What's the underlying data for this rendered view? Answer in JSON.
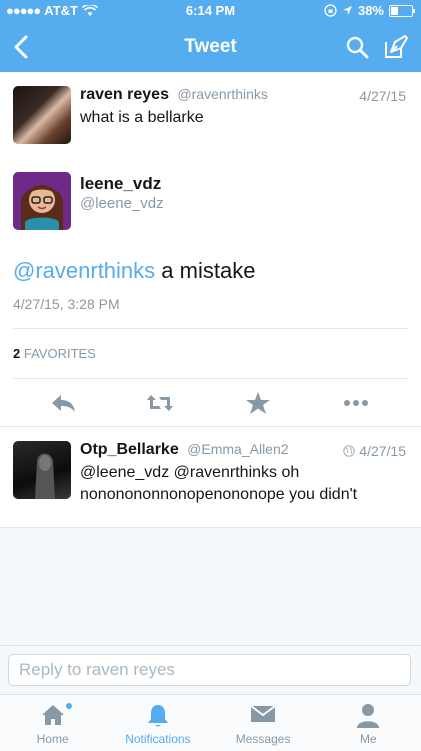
{
  "status_bar": {
    "carrier": "AT&T",
    "time": "6:14 PM",
    "battery": "38%",
    "battery_level": 0.38
  },
  "nav": {
    "title": "Tweet",
    "icons": [
      "back-chevron-icon",
      "search-icon",
      "compose-icon"
    ]
  },
  "reply_to": {
    "name": "raven reyes",
    "handle": "@ravenrthinks",
    "date": "4/27/15",
    "text": "what is a bellarke"
  },
  "main_tweet": {
    "name": "leene_vdz",
    "handle": "@leene_vdz",
    "mention": "@ravenrthinks",
    "text": " a mistake",
    "timestamp": "4/27/15, 3:28 PM",
    "favorites_count": "2",
    "favorites_label": "FAVORITES",
    "actions": [
      "reply-icon",
      "retweet-icon",
      "favorite-icon",
      "more-icon"
    ]
  },
  "replies": [
    {
      "name": "Otp_Bellarke",
      "handle": "@Emma_Allen2",
      "date": "4/27/15",
      "text": "@leene_vdz @ravenrthinks oh nononononnonopenononope you didn't"
    }
  ],
  "reply_box": {
    "placeholder": "Reply to raven reyes",
    "value": ""
  },
  "tabs": [
    {
      "label": "Home",
      "icon": "home-icon"
    },
    {
      "label": "Notifications",
      "icon": "bell-icon",
      "active": true
    },
    {
      "label": "Messages",
      "icon": "envelope-icon"
    },
    {
      "label": "Me",
      "icon": "person-icon"
    }
  ],
  "colors": {
    "brand": "#55acee",
    "text": "#14171a",
    "muted": "#8899a6",
    "border": "#e1e8ed"
  }
}
